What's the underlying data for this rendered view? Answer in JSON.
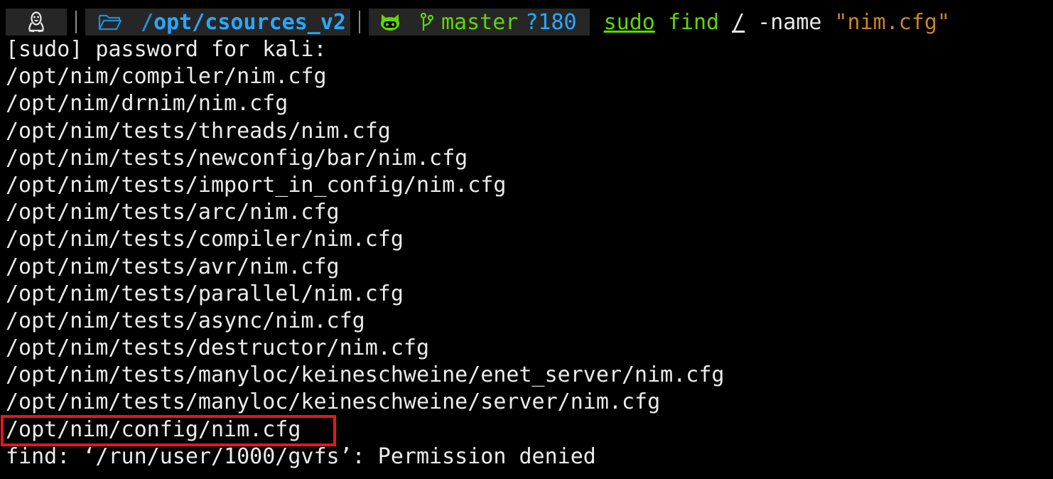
{
  "prompt": {
    "os_icon": "linux-tux-icon",
    "folder_icon": "folder-icon",
    "dir_prefix": "/",
    "dir_path": "opt/csources_v2",
    "github_icon": "github-icon",
    "branch_icon": "git-branch-icon",
    "branch": "master",
    "untracked": "?180",
    "colors": {
      "segment_bg": "#262626",
      "dir": "#28a8ff",
      "git": "#5fd700",
      "string": "#c9832a",
      "highlight": "#e8151b"
    }
  },
  "command": {
    "sudo": "sudo",
    "find": "find",
    "root": "/",
    "flag": "-name",
    "arg": "\"nim.cfg\""
  },
  "output": [
    "[sudo] password for kali:",
    "/opt/nim/compiler/nim.cfg",
    "/opt/nim/drnim/nim.cfg",
    "/opt/nim/tests/threads/nim.cfg",
    "/opt/nim/tests/newconfig/bar/nim.cfg",
    "/opt/nim/tests/import_in_config/nim.cfg",
    "/opt/nim/tests/arc/nim.cfg",
    "/opt/nim/tests/compiler/nim.cfg",
    "/opt/nim/tests/avr/nim.cfg",
    "/opt/nim/tests/parallel/nim.cfg",
    "/opt/nim/tests/async/nim.cfg",
    "/opt/nim/tests/destructor/nim.cfg",
    "/opt/nim/tests/manyloc/keineschweine/enet_server/nim.cfg",
    "/opt/nim/tests/manyloc/keineschweine/server/nim.cfg",
    "/opt/nim/config/nim.cfg",
    "find: ‘/run/user/1000/gvfs’: Permission denied"
  ]
}
